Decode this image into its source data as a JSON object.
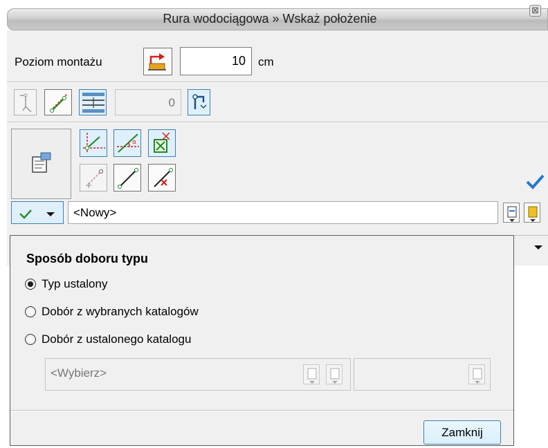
{
  "window": {
    "title": "Rura wodociągowa » Wskaż położenie",
    "close_glyph": "⊠"
  },
  "level": {
    "label": "Poziom montażu",
    "value": "10",
    "unit": "cm"
  },
  "row2": {
    "number_value": "0"
  },
  "type_selector": {
    "value": "<Nowy>"
  },
  "popup": {
    "heading": "Sposób doboru typu",
    "options": [
      {
        "label": "Typ ustalony",
        "checked": true
      },
      {
        "label": "Dobór z wybranych katalogów",
        "checked": false
      },
      {
        "label": "Dobór z ustalonego katalogu",
        "checked": false
      }
    ],
    "catalog_placeholder": "<Wybierz>",
    "close_label": "Zamknij"
  },
  "icons": {
    "level_pick": "level-pick-icon",
    "apply": "checkmark-icon",
    "dropdown": "chevron-down-icon"
  },
  "colors": {
    "accent": "#1e78d2",
    "selection_blue": "#dff0fc",
    "green_check": "#2a8a2a",
    "yellow_icon": "#f0c020"
  }
}
